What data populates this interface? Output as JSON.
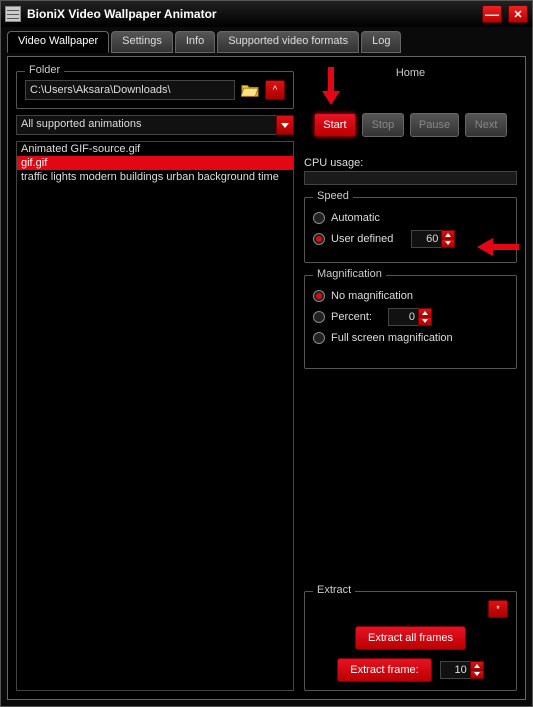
{
  "window": {
    "title": "BioniX Video Wallpaper Animator"
  },
  "tabs": {
    "video_wallpaper": "Video Wallpaper",
    "settings": "Settings",
    "info": "Info",
    "supported": "Supported video formats",
    "log": "Log"
  },
  "folder": {
    "legend": "Folder",
    "path": "C:\\Users\\Aksara\\Downloads\\",
    "up_label": "^"
  },
  "filter": {
    "selected": "All supported animations"
  },
  "files": {
    "items": [
      "Animated GIF-source.gif",
      "gif.gif",
      "traffic lights modern buildings urban background time"
    ],
    "selected_index": 1
  },
  "home": {
    "header": "Home",
    "start": "Start",
    "stop": "Stop",
    "pause": "Pause",
    "next": "Next"
  },
  "cpu": {
    "label": "CPU usage:"
  },
  "speed": {
    "legend": "Speed",
    "automatic": "Automatic",
    "user_defined": "User defined",
    "value": "60",
    "selected": "user_defined"
  },
  "magnification": {
    "legend": "Magnification",
    "no_mag": "No magnification",
    "percent_label": "Percent:",
    "percent_value": "0",
    "fullscreen": "Full screen magnification",
    "selected": "none"
  },
  "extract": {
    "legend": "Extract",
    "star": "*",
    "all_frames": "Extract all frames",
    "frame_label": "Extract frame:",
    "frame_value": "10"
  }
}
